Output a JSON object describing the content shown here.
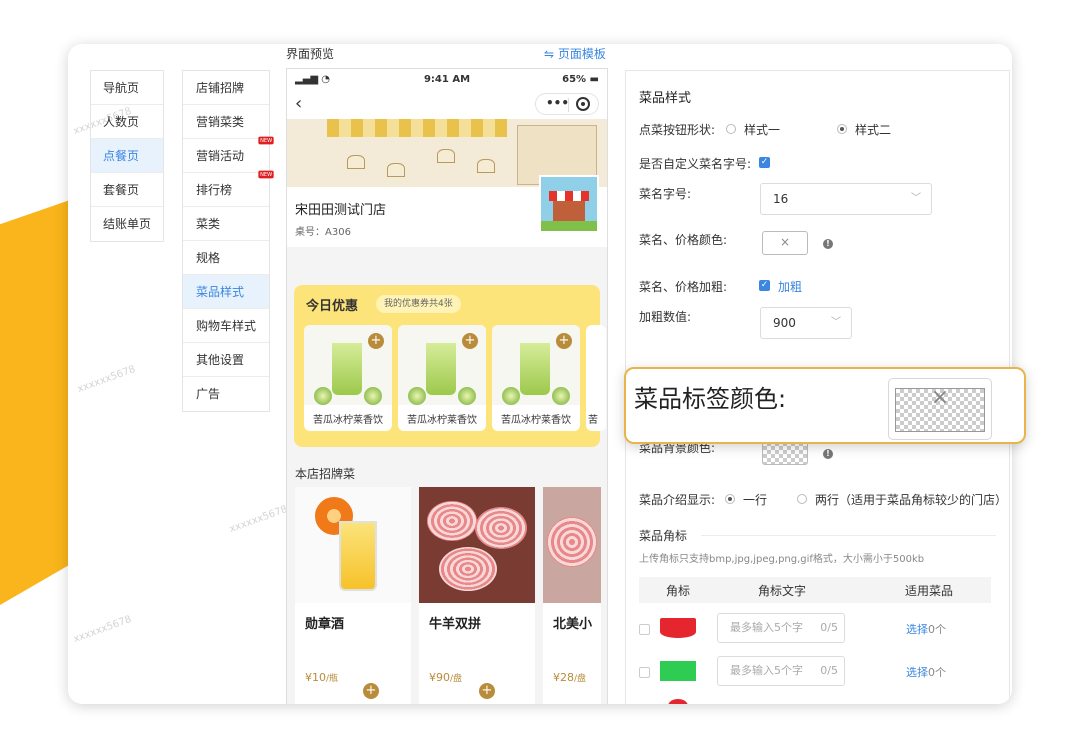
{
  "nav_primary": [
    "导航页",
    "人数页",
    "点餐页",
    "套餐页",
    "结账单页"
  ],
  "nav_secondary": [
    "店铺招牌",
    "营销菜类",
    "营销活动",
    "排行榜",
    "菜类",
    "规格",
    "菜品样式",
    "购物车样式",
    "其他设置",
    "广告"
  ],
  "new_badge": "NEW",
  "preview": {
    "title": "界面预览",
    "template_link": "⇋ 页面模板"
  },
  "phone": {
    "signal": "▂▄▆ ◔",
    "time": "9:41 AM",
    "battery": "65% ▬",
    "back": "‹",
    "menu_dots": "•••",
    "store_name": "宋田田测试门店",
    "table_no": "桌号：A306",
    "promo": {
      "title": "今日优惠",
      "coupon_note": "我的优惠券共4张",
      "items": [
        "苦瓜冰柠莱香饮",
        "苦瓜冰柠莱香饮",
        "苦瓜冰柠莱香饮",
        "苦"
      ]
    },
    "signature": {
      "title": "本店招牌菜",
      "items": [
        {
          "name": "勋章酒",
          "price": "¥10",
          "unit": "/瓶"
        },
        {
          "name": "牛羊双拼",
          "price": "¥90",
          "unit": "/盘"
        },
        {
          "name": "北美小",
          "price": "¥28",
          "unit": "/盘"
        }
      ]
    }
  },
  "settings": {
    "title": "菜品样式",
    "btn_shape": {
      "label": "点菜按钮形状:",
      "opt1": "样式一",
      "opt2": "样式二"
    },
    "custom_font": {
      "label": "是否自定义菜名字号:"
    },
    "font_size": {
      "label": "菜名字号:",
      "value": "16"
    },
    "name_price_color": {
      "label": "菜名、价格颜色:"
    },
    "bold": {
      "label": "菜名、价格加粗:",
      "text": "加粗"
    },
    "bold_value": {
      "label": "加粗数值:",
      "value": "900"
    },
    "bg_color": {
      "label": "菜品背景颜色:"
    },
    "intro": {
      "label": "菜品介绍显示:",
      "opt1": "一行",
      "opt2": "两行（适用于菜品角标较少的门店）"
    },
    "corner": {
      "title": "菜品角标",
      "hint": "上传角标只支持bmp,jpg,jpeg,png,gif格式，大小需小于500kb"
    },
    "table": {
      "headers": [
        "角标",
        "角标文字",
        "适用菜品"
      ],
      "placeholder": "最多输入5个字",
      "count": "0/5",
      "select_text": "选择",
      "select_count": "0个"
    }
  },
  "popup": {
    "label": "菜品标签颜色:"
  },
  "swatch_close": "×",
  "watermark": "xxxxxx5678",
  "colors": {
    "accent": "#3a86e0",
    "brand_yellow": "#f9b51b",
    "promo_bg": "#fde47a",
    "popup_border": "#e8b54a",
    "tag_red": "#e5262e",
    "tag_green": "#2ecc52"
  }
}
